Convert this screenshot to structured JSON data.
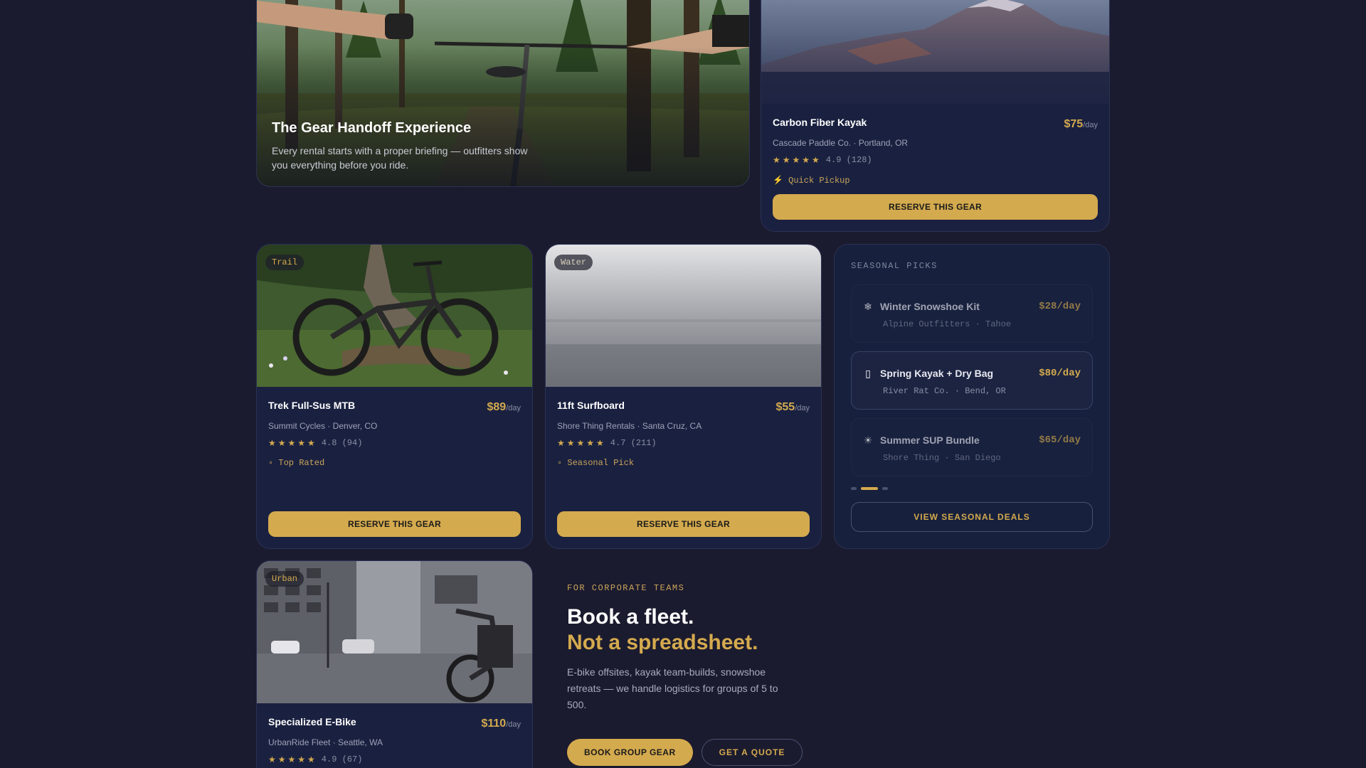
{
  "hero": {
    "title": "The Gear Handoff Experience",
    "description": "Every rental starts with a proper briefing — outfitters show you everything before you ride."
  },
  "featured": {
    "name": "Carbon Fiber Kayak",
    "price": "$75",
    "per": "/day",
    "vendor": "Cascade Paddle Co. · Portland, OR",
    "stars": "★★★★★",
    "rating": "4.9 (128)",
    "badge": "⚡ Quick Pickup",
    "reserve_label": "RESERVE THIS GEAR"
  },
  "gear": [
    {
      "tag": "Trail",
      "name": "Trek Full-Sus MTB",
      "price": "$89",
      "per": "/day",
      "vendor": "Summit Cycles · Denver, CO",
      "stars": "★★★★★",
      "rating": "4.8 (94)",
      "badge": "▫ Top Rated",
      "reserve_label": "RESERVE THIS GEAR"
    },
    {
      "tag": "Water",
      "name": "11ft Surfboard",
      "price": "$55",
      "per": "/day",
      "vendor": "Shore Thing Rentals · Santa Cruz, CA",
      "stars": "★★★★★",
      "rating": "4.7 (211)",
      "badge": "▫ Seasonal Pick",
      "reserve_label": "RESERVE THIS GEAR"
    },
    {
      "tag": "Urban",
      "name": "Specialized E-Bike",
      "price": "$110",
      "per": "/day",
      "vendor": "UrbanRide Fleet · Seattle, WA",
      "stars": "★★★★★",
      "rating": "4.9 (67)"
    }
  ],
  "seasonal": {
    "label": "SEASONAL PICKS",
    "items": [
      {
        "icon": "❄",
        "name": "Winter Snowshoe Kit",
        "price": "$28/day",
        "vendor": "Alpine Outfitters · Tahoe"
      },
      {
        "icon": "▯",
        "name": "Spring Kayak + Dry Bag",
        "price": "$80/day",
        "vendor": "River Rat Co. · Bend, OR"
      },
      {
        "icon": "☀",
        "name": "Summer SUP Bundle",
        "price": "$65/day",
        "vendor": "Shore Thing · San Diego"
      }
    ],
    "active_index": 1,
    "view_label": "VIEW SEASONAL DEALS"
  },
  "corporate": {
    "label": "FOR CORPORATE TEAMS",
    "headline_1": "Book a fleet.",
    "headline_2": "Not a spreadsheet.",
    "description": "E-bike offsites, kayak team-builds, snowshoe retreats — we handle logistics for groups of 5 to 500.",
    "primary_label": "BOOK GROUP GEAR",
    "secondary_label": "GET A QUOTE"
  },
  "colors": {
    "background": "#1b1b2f",
    "card": "#1a2140",
    "accent": "#d4aa4e"
  }
}
